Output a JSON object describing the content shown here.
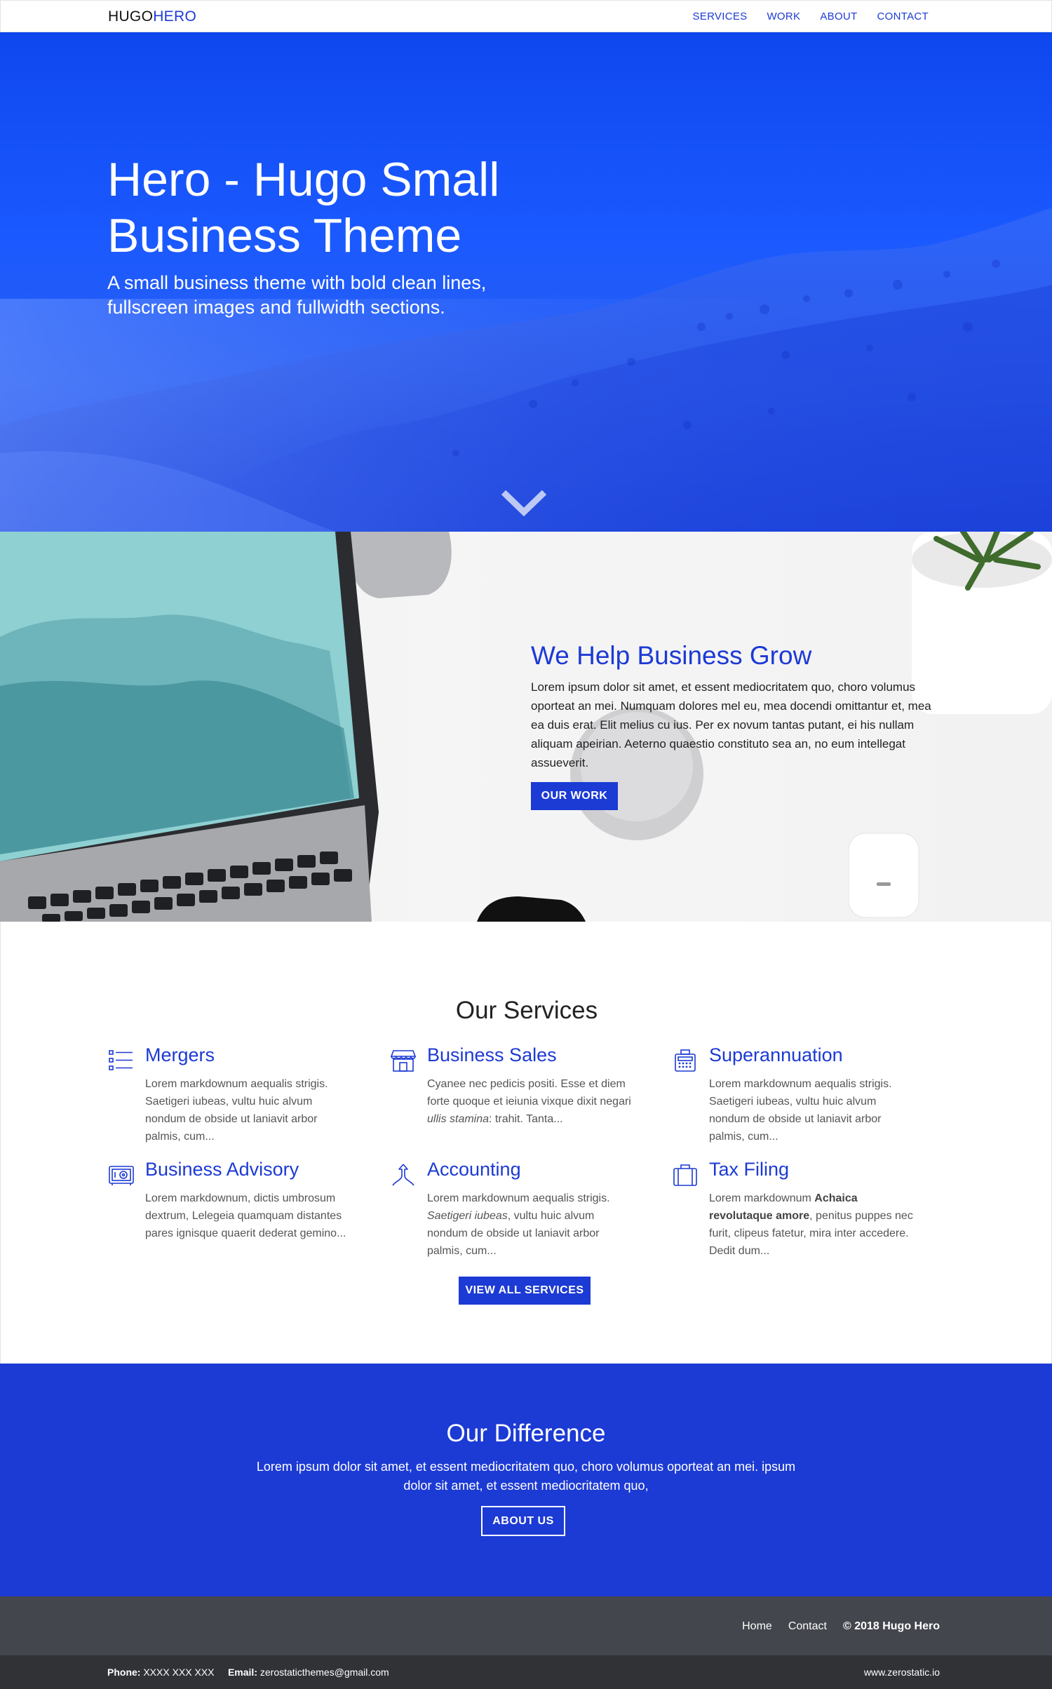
{
  "header": {
    "logo_part1": "HUGO",
    "logo_part2": "HERO",
    "nav": [
      "SERVICES",
      "WORK",
      "ABOUT",
      "CONTACT"
    ]
  },
  "hero": {
    "title": "Hero - Hugo Small Business Theme",
    "subtitle": "A small business theme with bold clean lines, fullscreen images and fullwidth sections.",
    "scroll_icon": "chevron-down-icon"
  },
  "grow": {
    "title": "We Help Business Grow",
    "text": "Lorem ipsum dolor sit amet, et essent mediocritatem quo, choro volumus oporteat an mei. Numquam dolores mel eu, mea docendi omittantur et, mea ea duis erat. Elit melius cu ius. Per ex novum tantas putant, ei his nullam aliquam apeirian. Aeterno quaestio constituto sea an, no eum intellegat assueverit.",
    "button": "OUR WORK"
  },
  "services": {
    "title": "Our Services",
    "items": [
      {
        "icon": "checklist-icon",
        "title": "Mergers",
        "text": "Lorem markdownum aequalis strigis. Saetigeri iubeas, vultu huic alvum nondum de obside ut laniavit arbor palmis, cum..."
      },
      {
        "icon": "storefront-icon",
        "title": "Business Sales",
        "text_before": "Cyanee nec pedicis positi. Esse et diem forte quoque et ieiunia vixque dixit negari ",
        "text_em": "ullis stamina",
        "text_after": ": trahit. Tanta..."
      },
      {
        "icon": "cash-register-icon",
        "title": "Superannuation",
        "text": "Lorem markdownum aequalis strigis. Saetigeri iubeas, vultu huic alvum nondum de obside ut laniavit arbor palmis, cum..."
      },
      {
        "icon": "safe-icon",
        "title": "Business Advisory",
        "text": "Lorem markdownum, dictis umbrosum dextrum, Lelegeia quamquam distantes pares ignisque quaerit dederat gemino..."
      },
      {
        "icon": "merge-arrows-icon",
        "title": "Accounting",
        "text_before": "Lorem markdownum aequalis strigis. ",
        "text_em": "Saetigeri iubeas",
        "text_after": ", vultu huic alvum nondum de obside ut laniavit arbor palmis, cum..."
      },
      {
        "icon": "briefcase-icon",
        "title": "Tax Filing",
        "text_before": "Lorem markdownum ",
        "text_bold": "Achaica revolutaque amore",
        "text_after": ", penitus puppes nec furit, clipeus fatetur, mira inter accedere. Dedit dum..."
      }
    ],
    "button": "VIEW ALL SERVICES"
  },
  "difference": {
    "title": "Our Difference",
    "text": "Lorem ipsum dolor sit amet, et essent mediocritatem quo, choro volumus oporteat an mei. ipsum dolor sit amet, et essent mediocritatem quo,",
    "button": "ABOUT US"
  },
  "footer": {
    "links": [
      "Home",
      "Contact"
    ],
    "copyright": "© 2018 Hugo Hero",
    "phone_label": "Phone:",
    "phone": "XXXX XXX XXX",
    "email_label": "Email:",
    "email": "zerostaticthemes@gmail.com",
    "site": "www.zerostatic.io"
  },
  "colors": {
    "accent": "#1c3ad4",
    "footer_bg": "#43464c",
    "subfooter_bg": "#303236"
  }
}
